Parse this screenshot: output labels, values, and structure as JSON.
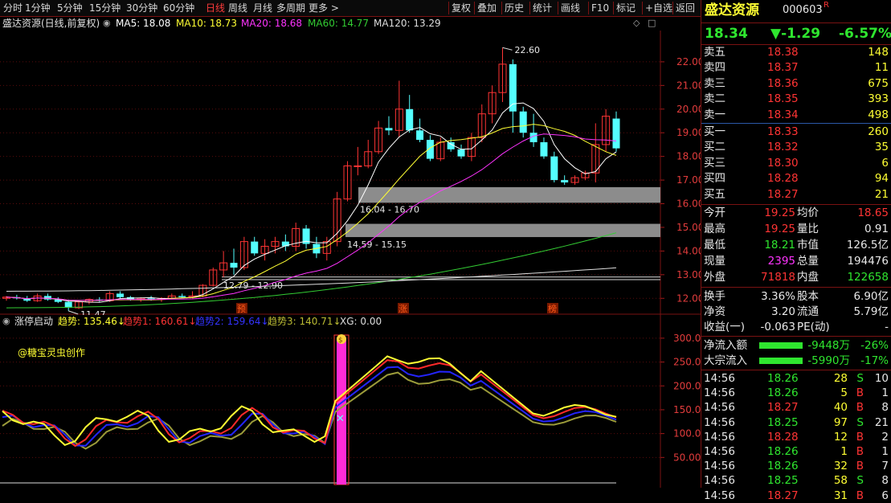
{
  "toolbar": {
    "periods": [
      "分时",
      "1分钟",
      "5分钟",
      "15分钟",
      "30分钟",
      "60分钟",
      "日线",
      "周线",
      "月线",
      "多周期",
      "更多 >"
    ],
    "active_period": "日线",
    "actions": [
      "复权",
      "叠加",
      "历史",
      "统计",
      "画线",
      "F10",
      "标记",
      "+自选",
      "返回"
    ]
  },
  "stock": {
    "name": "盛达资源",
    "code": "000603",
    "badge": "R",
    "price": "18.34",
    "change": "▼-1.29",
    "pct": "-6.57%"
  },
  "legend": {
    "title": "盛达资源(日线,前复权)",
    "ma5": "MA5: 18.08",
    "ma10": "MA10: 18.73",
    "ma20": "MA20: 18.68",
    "ma60": "MA60: 14.77",
    "ma120": "MA120: 13.29"
  },
  "colors": {
    "up": "#ff3434",
    "down": "#54ffff",
    "ma5": "#ffffff",
    "ma10": "#ffff33",
    "ma20": "#ff33ff",
    "ma60": "#33cc33",
    "ma120": "#e0e0e0",
    "zone": "#8c8c8c"
  },
  "chart_data": [
    {
      "type": "candlestick",
      "ylim": [
        11.5,
        22.8
      ],
      "ytick_labels": [
        "22.00",
        "21.00",
        "20.00",
        "19.00",
        "18.00",
        "17.00",
        "16.00",
        "15.00",
        "14.00",
        "13.00",
        "12.00"
      ],
      "annotations": {
        "high_label": "22.60",
        "low_label": "11.47",
        "zones": [
          "16.04 - 16.70",
          "14.59 - 15.15",
          "12.79 - 12.90"
        ],
        "markers": [
          "预",
          "涨",
          "榜"
        ]
      },
      "candles": [
        [
          12.0,
          12.1,
          11.9,
          12.05
        ],
        [
          12.05,
          12.15,
          11.95,
          12.0
        ],
        [
          12.0,
          12.1,
          11.85,
          11.9
        ],
        [
          11.9,
          12.2,
          11.85,
          12.1
        ],
        [
          12.1,
          12.2,
          11.9,
          11.95
        ],
        [
          11.95,
          12.05,
          11.8,
          11.85
        ],
        [
          11.85,
          11.95,
          11.47,
          11.6
        ],
        [
          11.6,
          11.9,
          11.55,
          11.85
        ],
        [
          11.85,
          12.0,
          11.75,
          11.95
        ],
        [
          11.95,
          12.05,
          11.85,
          11.9
        ],
        [
          11.9,
          12.3,
          11.85,
          12.2
        ],
        [
          12.2,
          12.3,
          12.0,
          12.05
        ],
        [
          12.05,
          12.1,
          11.9,
          11.95
        ],
        [
          11.95,
          12.05,
          11.85,
          12.0
        ],
        [
          12.0,
          12.1,
          11.9,
          11.95
        ],
        [
          11.95,
          12.05,
          11.85,
          12.0
        ],
        [
          12.0,
          12.2,
          11.95,
          12.1
        ],
        [
          12.1,
          12.2,
          12.0,
          12.05
        ],
        [
          12.05,
          12.3,
          12.0,
          12.1
        ],
        [
          12.1,
          12.6,
          12.05,
          12.55
        ],
        [
          12.55,
          13.3,
          12.5,
          13.2
        ],
        [
          13.2,
          14.0,
          12.9,
          13.5
        ],
        [
          13.5,
          14.1,
          13.0,
          13.3
        ],
        [
          13.3,
          14.6,
          13.2,
          14.4
        ],
        [
          14.4,
          14.6,
          13.8,
          13.9
        ],
        [
          13.9,
          14.5,
          13.6,
          14.2
        ],
        [
          14.2,
          14.6,
          13.9,
          14.4
        ],
        [
          14.4,
          14.7,
          14.0,
          14.2
        ],
        [
          14.2,
          15.2,
          14.0,
          14.95
        ],
        [
          14.95,
          15.1,
          14.1,
          14.3
        ],
        [
          14.3,
          14.6,
          13.7,
          13.9
        ],
        [
          13.9,
          14.6,
          13.6,
          14.4
        ],
        [
          14.4,
          16.5,
          14.2,
          16.2
        ],
        [
          16.2,
          17.8,
          16.1,
          17.6
        ],
        [
          17.6,
          18.4,
          17.2,
          17.6
        ],
        [
          17.6,
          18.7,
          17.5,
          18.2
        ],
        [
          18.2,
          19.5,
          18.1,
          19.2
        ],
        [
          19.2,
          19.7,
          18.9,
          19.1
        ],
        [
          19.1,
          21.2,
          18.8,
          20.0
        ],
        [
          20.0,
          20.6,
          19.0,
          19.1
        ],
        [
          19.1,
          19.6,
          18.6,
          18.7
        ],
        [
          18.7,
          18.9,
          17.8,
          17.9
        ],
        [
          17.9,
          18.8,
          17.8,
          18.6
        ],
        [
          18.6,
          18.8,
          18.2,
          18.3
        ],
        [
          18.3,
          18.5,
          17.9,
          18.0
        ],
        [
          18.0,
          19.0,
          17.8,
          18.8
        ],
        [
          18.8,
          20.2,
          18.6,
          19.8
        ],
        [
          19.8,
          21.0,
          19.4,
          20.7
        ],
        [
          20.7,
          22.6,
          20.3,
          21.9
        ],
        [
          21.9,
          22.1,
          19.0,
          19.9
        ],
        [
          19.9,
          20.1,
          18.8,
          19.0
        ],
        [
          19.0,
          19.8,
          18.4,
          18.6
        ],
        [
          18.6,
          18.8,
          17.9,
          18.0
        ],
        [
          18.0,
          18.2,
          16.9,
          17.0
        ],
        [
          17.0,
          17.2,
          16.8,
          16.9
        ],
        [
          16.9,
          17.2,
          16.8,
          17.1
        ],
        [
          17.1,
          17.4,
          17.0,
          17.3
        ],
        [
          17.3,
          19.4,
          16.9,
          18.5
        ],
        [
          18.5,
          20.0,
          18.2,
          19.7
        ],
        [
          19.6,
          19.9,
          18.2,
          18.34
        ]
      ]
    },
    {
      "type": "line",
      "ylim": [
        0,
        320
      ],
      "ytick_labels": [
        "300.0",
        "250.0",
        "200.0",
        "150.0",
        "100.0",
        "50.00"
      ],
      "legend": {
        "title": "涨停启动",
        "t1": "趋势: 135.46↓",
        "t2": "趋势1: 160.61↓",
        "t3": "趋势2: 159.64↓",
        "t4": "趋势3: 140.71↓",
        "t5": "XG: 0.00"
      },
      "signature": "@糖宝灵虫创作",
      "signal_label": "$"
    }
  ],
  "quotes": {
    "asks": [
      [
        "卖五",
        "18.38",
        "148"
      ],
      [
        "卖四",
        "18.37",
        "11"
      ],
      [
        "卖三",
        "18.36",
        "675"
      ],
      [
        "卖二",
        "18.35",
        "393"
      ],
      [
        "卖一",
        "18.34",
        "498"
      ]
    ],
    "bids": [
      [
        "买一",
        "18.33",
        "260"
      ],
      [
        "买二",
        "18.32",
        "35"
      ],
      [
        "买三",
        "18.30",
        "6"
      ],
      [
        "买四",
        "18.28",
        "94"
      ],
      [
        "买五",
        "18.27",
        "21"
      ]
    ]
  },
  "stats": [
    [
      "今开",
      "19.25",
      "均价",
      "18.65"
    ],
    [
      "最高",
      "19.25",
      "量比",
      "0.91"
    ],
    [
      "最低",
      "18.21",
      "市值",
      "126.5亿"
    ],
    [
      "现量",
      "2395",
      "总量",
      "194476"
    ],
    [
      "外盘",
      "71818",
      "内盘",
      "122658"
    ]
  ],
  "stats2": [
    [
      "换手",
      "3.36%",
      "股本",
      "6.90亿"
    ],
    [
      "净资",
      "3.20",
      "流通",
      "5.79亿"
    ],
    [
      "收益(一)",
      "-0.063",
      "PE(动)",
      "-"
    ]
  ],
  "flow": [
    [
      "净流入额",
      "-9448万",
      "-26%"
    ],
    [
      "大宗流入",
      "-5990万",
      "-17%"
    ]
  ],
  "ticks": [
    [
      "14:56",
      "18.26",
      "28",
      "S",
      "10"
    ],
    [
      "14:56",
      "18.26",
      "5",
      "B",
      "1"
    ],
    [
      "14:56",
      "18.27",
      "40",
      "B",
      "8"
    ],
    [
      "14:56",
      "18.25",
      "97",
      "S",
      "21"
    ],
    [
      "14:56",
      "18.28",
      "12",
      "B",
      "2"
    ],
    [
      "14:56",
      "18.26",
      "1",
      "B",
      "1"
    ],
    [
      "14:56",
      "18.26",
      "32",
      "B",
      "7"
    ],
    [
      "14:56",
      "18.25",
      "58",
      "S",
      "8"
    ],
    [
      "14:56",
      "18.27",
      "31",
      "B",
      "6"
    ]
  ]
}
